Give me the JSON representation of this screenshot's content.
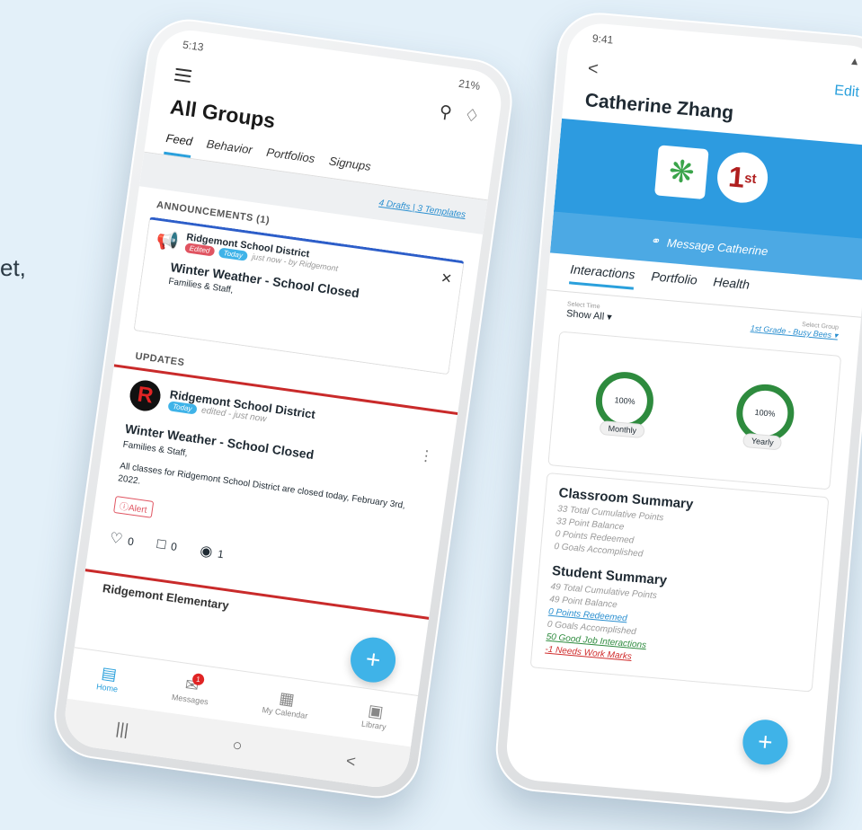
{
  "side_text": "et,",
  "left_phone": {
    "status": {
      "time": "5:13",
      "battery": "21%"
    },
    "title": "All Groups",
    "tabs": [
      "Feed",
      "Behavior",
      "Portfolios",
      "Signups"
    ],
    "drafts_link": "4 Drafts | 3 Templates",
    "announcements_label": "ANNOUNCEMENTS (1)",
    "announcement": {
      "org": "Ridgemont School District",
      "badge_edited": "Edited",
      "badge_today": "Today",
      "meta": "just now - by Ridgemont",
      "title": "Winter Weather - School Closed",
      "subtitle": "Families & Staff,"
    },
    "updates_label": "UPDATES",
    "post": {
      "logo_letter": "R",
      "org": "Ridgemont School District",
      "badge_today": "Today",
      "meta": "edited - just now",
      "title": "Winter Weather - School Closed",
      "subtitle": "Families & Staff,",
      "body": "All classes for Ridgemont School District are closed today, February 3rd, 2022.",
      "alert": "ⓘAlert",
      "likes": "0",
      "comments": "0",
      "views": "1"
    },
    "next_post_org": "Ridgemont Elementary",
    "fab": "+",
    "nav": [
      {
        "label": "Home",
        "icon": "▤"
      },
      {
        "label": "Messages",
        "icon": "✉",
        "badge": "1"
      },
      {
        "label": "My Calendar",
        "icon": "▦"
      },
      {
        "label": "Library",
        "icon": "▣"
      }
    ],
    "system_nav": [
      "|||",
      "○",
      "<"
    ]
  },
  "right_phone": {
    "status": {
      "time": "9:41"
    },
    "back": "<",
    "edit": "Edit",
    "student_name": "Catherine Zhang",
    "rank": "1",
    "rank_suffix": "st",
    "message_button": "Message Catherine",
    "tabs": [
      "Interactions",
      "Portfolio",
      "Health"
    ],
    "filters": {
      "time_label": "Select Time",
      "time_value": "Show All ▾",
      "group_label": "Select Group",
      "group_value": "1st Grade - Busy Bees ▾"
    },
    "progress": [
      {
        "label": "Monthly",
        "value": "100%",
        "fraction": 1.0
      },
      {
        "label": "Yearly",
        "value": "100%",
        "fraction": 1.0
      }
    ],
    "classroom_summary": {
      "title": "Classroom Summary",
      "lines": [
        "33 Total Cumulative Points",
        "33 Point Balance",
        "0 Points Redeemed",
        "0 Goals Accomplished"
      ]
    },
    "student_summary": {
      "title": "Student Summary",
      "lines": [
        "49 Total Cumulative Points",
        "49 Point Balance"
      ],
      "redeemed": "0 Points Redeemed",
      "goals": "0 Goals Accomplished",
      "good": "50 Good Job Interactions",
      "needs": "-1 Needs Work Marks"
    },
    "fab": "+"
  }
}
